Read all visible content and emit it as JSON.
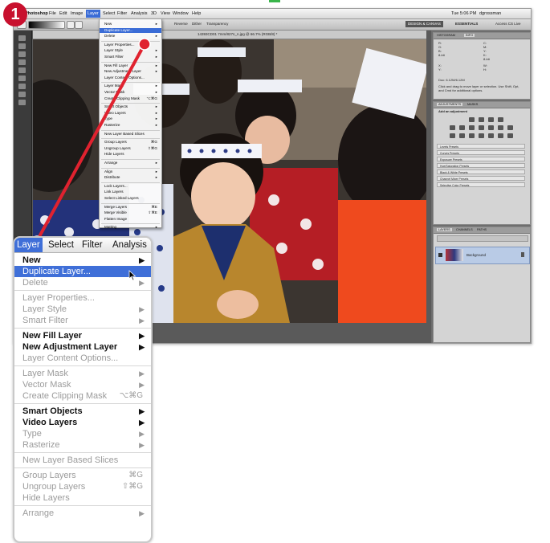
{
  "step_number": "1",
  "screenshot": {
    "menubar": {
      "app_name": "Photoshop",
      "items": [
        "File",
        "Edit",
        "Image",
        "Layer",
        "Select",
        "Filter",
        "Analysis",
        "3D",
        "View",
        "Window",
        "Help"
      ],
      "active_item": "Layer",
      "clock": "Tue 5:06 PM",
      "user": "dgrossman"
    },
    "options_bar": {
      "checkbox_reverse": "Reverse",
      "checkbox_dither": "Dither",
      "checkbox_transparency": "Transparency",
      "workspace_buttons": [
        "DESIGN & CANVAS",
        "ESSENTIALS"
      ],
      "cs_live": "Access CS Live"
    },
    "document_tab": "14393CD01 7mm/827n_n.jpg @ 66.7% (RGB/8) *",
    "small_menu": {
      "items": [
        {
          "label": "New",
          "arrow": true
        },
        {
          "label": "Duplicate Layer...",
          "selected": true
        },
        {
          "label": "Delete",
          "arrow": true
        },
        {
          "label": "Layer Properties..."
        },
        {
          "label": "Layer Style",
          "arrow": true
        },
        {
          "label": "Smart Filter",
          "arrow": true
        },
        {
          "label": "New Fill Layer",
          "arrow": true
        },
        {
          "label": "New Adjustment Layer",
          "arrow": true
        },
        {
          "label": "Layer Content Options..."
        },
        {
          "label": "Layer Mask",
          "arrow": true
        },
        {
          "label": "Vector Mask",
          "arrow": true
        },
        {
          "label": "Create Clipping Mask",
          "shortcut": "⌥⌘G"
        },
        {
          "label": "Smart Objects",
          "arrow": true
        },
        {
          "label": "Video Layers",
          "arrow": true
        },
        {
          "label": "Type",
          "arrow": true
        },
        {
          "label": "Rasterize",
          "arrow": true
        },
        {
          "label": "New Layer Based Slices"
        },
        {
          "label": "Group Layers",
          "shortcut": "⌘G"
        },
        {
          "label": "Ungroup Layers",
          "shortcut": "⇧⌘G"
        },
        {
          "label": "Hide Layers"
        },
        {
          "label": "Arrange",
          "arrow": true
        },
        {
          "label": "Align",
          "arrow": true
        },
        {
          "label": "Distribute",
          "arrow": true
        },
        {
          "label": "Lock Layers..."
        },
        {
          "label": "Link Layers"
        },
        {
          "label": "Select Linked Layers"
        },
        {
          "label": "Merge Layers",
          "shortcut": "⌘E"
        },
        {
          "label": "Merge Visible",
          "shortcut": "⇧⌘E"
        },
        {
          "label": "Flatten Image"
        },
        {
          "label": "Matting",
          "arrow": true
        }
      ]
    },
    "panels": {
      "histogram_tabs": [
        "HISTOGRAM",
        "INFO"
      ],
      "info_values": [
        "R:",
        "G:",
        "B:",
        "8-bit",
        "C:",
        "M:",
        "Y:",
        "K:",
        "8-bit",
        "X:",
        "Y:",
        "W:",
        "H:",
        "Doc: 6.12M/6.12M"
      ],
      "info_hint": "Click and drag to move layer or selection. Use Shift, Opt, and Cmd for additional options.",
      "adjustments_tabs": [
        "ADJUSTMENTS",
        "MASKS"
      ],
      "adjustments_title": "Add an adjustment",
      "presets": [
        "Levels Presets",
        "Curves Presets",
        "Exposure Presets",
        "Hue/Saturation Presets",
        "Black & White Presets",
        "Channel Mixer Presets",
        "Selective Color Presets"
      ],
      "layers_tabs": [
        "LAYERS",
        "CHANNELS",
        "PATHS"
      ],
      "layer_name": "Background"
    }
  },
  "callout_menu": {
    "menubar": [
      "Layer",
      "Select",
      "Filter",
      "Analysis"
    ],
    "active": "Layer",
    "items": [
      {
        "label": "New",
        "style": "bold",
        "arrow": true
      },
      {
        "label": "Duplicate Layer...",
        "style": "selected"
      },
      {
        "label": "Delete",
        "style": "disabled",
        "arrow": true
      },
      {
        "label": "Layer Properties...",
        "style": "disabled"
      },
      {
        "label": "Layer Style",
        "style": "disabled",
        "arrow": true
      },
      {
        "label": "Smart Filter",
        "style": "disabled",
        "arrow": true
      },
      {
        "label": "New Fill Layer",
        "style": "bold",
        "arrow": true
      },
      {
        "label": "New Adjustment Layer",
        "style": "bold",
        "arrow": true
      },
      {
        "label": "Layer Content Options...",
        "style": "disabled"
      },
      {
        "label": "Layer Mask",
        "style": "disabled",
        "arrow": true
      },
      {
        "label": "Vector Mask",
        "style": "disabled",
        "arrow": true
      },
      {
        "label": "Create Clipping Mask",
        "style": "disabled",
        "shortcut": "⌥⌘G"
      },
      {
        "label": "Smart Objects",
        "style": "bold",
        "arrow": true
      },
      {
        "label": "Video Layers",
        "style": "bold",
        "arrow": true
      },
      {
        "label": "Type",
        "style": "disabled",
        "arrow": true
      },
      {
        "label": "Rasterize",
        "style": "disabled",
        "arrow": true
      },
      {
        "label": "New Layer Based Slices",
        "style": "disabled"
      },
      {
        "label": "Group Layers",
        "style": "disabled",
        "shortcut": "⌘G"
      },
      {
        "label": "Ungroup Layers",
        "style": "disabled",
        "shortcut": "⇧⌘G"
      },
      {
        "label": "Hide Layers",
        "style": "disabled"
      },
      {
        "label": "Arrange",
        "style": "disabled",
        "arrow": true
      }
    ]
  },
  "colors": {
    "badge": "#c8102e",
    "connector": "#e0222f",
    "highlight": "#3f6fd8"
  },
  "icons": [
    "apple-icon",
    "pointer-cursor-icon",
    "submenu-arrow-icon"
  ]
}
